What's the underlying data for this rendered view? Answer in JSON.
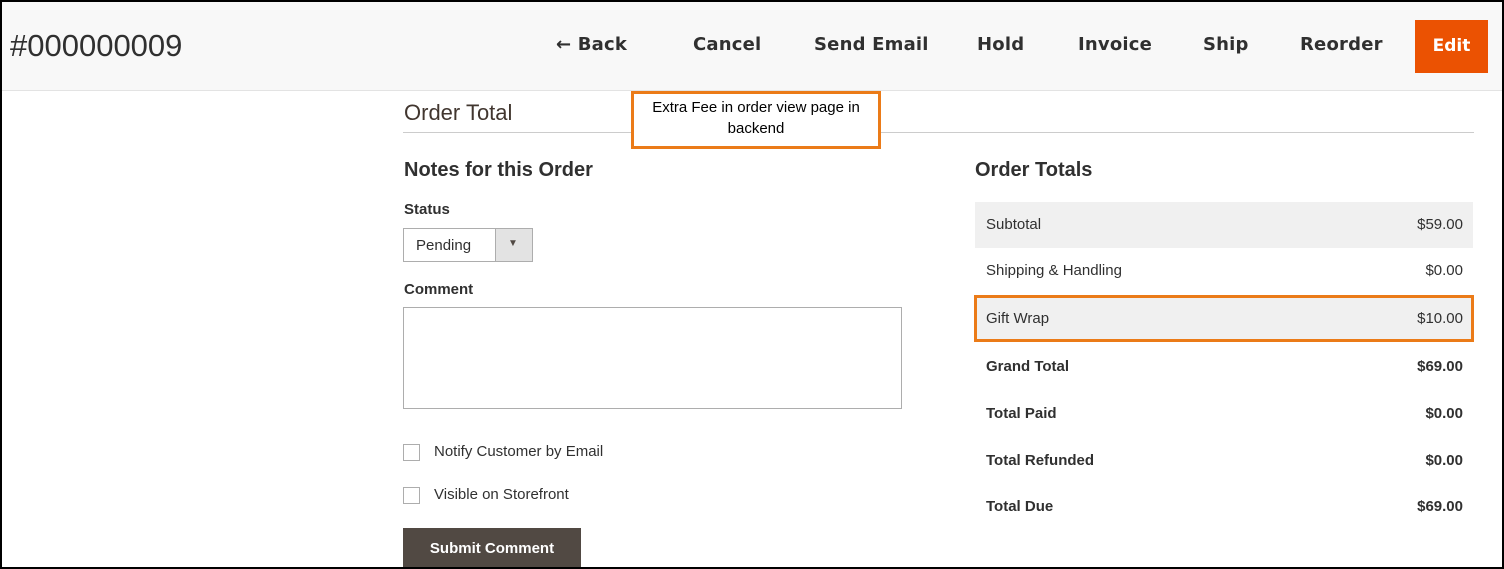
{
  "header": {
    "order_id": "#000000009",
    "actions": {
      "back": "← Back",
      "cancel": "Cancel",
      "send_email": "Send Email",
      "hold": "Hold",
      "invoice": "Invoice",
      "ship": "Ship",
      "reorder": "Reorder",
      "edit": "Edit"
    }
  },
  "order_total": {
    "title": "Order Total",
    "callout": "Extra Fee in order view page in backend"
  },
  "notes": {
    "title": "Notes for this Order",
    "status_label": "Status",
    "status_value": "Pending",
    "comment_label": "Comment",
    "comment_value": "",
    "notify_label": "Notify Customer by Email",
    "visible_label": "Visible on Storefront",
    "submit_label": "Submit Comment"
  },
  "totals": {
    "title": "Order Totals",
    "rows": [
      {
        "label": "Subtotal",
        "value": "$59.00"
      },
      {
        "label": "Shipping & Handling",
        "value": "$0.00"
      },
      {
        "label": "Gift Wrap",
        "value": "$10.00"
      },
      {
        "label": "Grand Total",
        "value": "$69.00"
      },
      {
        "label": "Total Paid",
        "value": "$0.00"
      },
      {
        "label": "Total Refunded",
        "value": "$0.00"
      },
      {
        "label": "Total Due",
        "value": "$69.00"
      }
    ]
  },
  "colors": {
    "accent": "#eb5202",
    "callout_border": "#eb7b18",
    "submit_bg": "#514943"
  }
}
